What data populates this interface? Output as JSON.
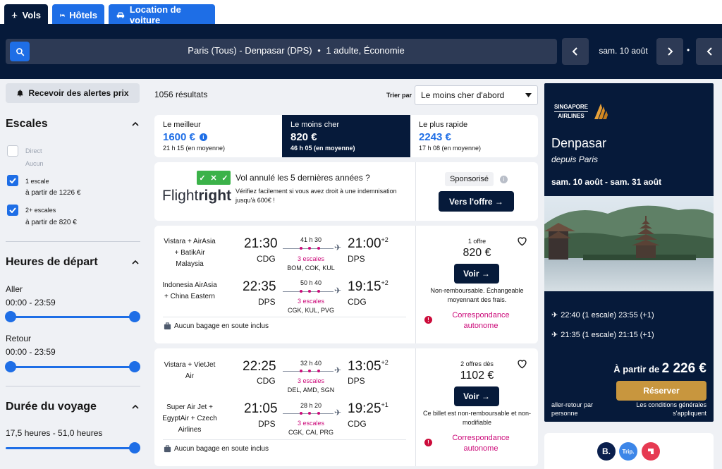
{
  "tabs": [
    {
      "label": "Vols",
      "icon": "plane-icon"
    },
    {
      "label": "Hôtels",
      "icon": "bed-icon"
    },
    {
      "label": "Location de voiture",
      "icon": "car-icon"
    }
  ],
  "search": {
    "route": "Paris (Tous) - Denpasar (DPS)",
    "separator": "•",
    "travellers": "1 adulte, Économie",
    "date": "sam. 10 août",
    "dot": "•"
  },
  "sidebar": {
    "alert_label": "Recevoir des alertes prix",
    "stops_title": "Escales",
    "stops": [
      {
        "label": "Direct",
        "sub": "Aucun",
        "checked": false
      },
      {
        "label": "1 escale",
        "sub": "à partir de 1226 €",
        "checked": true
      },
      {
        "label": "2+ escales",
        "sub": "à partir de 820 €",
        "checked": true
      }
    ],
    "departure_title": "Heures de départ",
    "outbound_label": "Aller",
    "outbound_range": "00:00 - 23:59",
    "return_label": "Retour",
    "return_range": "00:00 - 23:59",
    "duration_title": "Durée du voyage",
    "duration_range": "17,5 heures - 51,0 heures"
  },
  "results": {
    "count": "1056 résultats",
    "sort_label": "Trier par",
    "sort_value": "Le moins cher d'abord"
  },
  "sort_tabs": [
    {
      "title": "Le meilleur",
      "price": "1600 €",
      "duration": "21 h 15 (en moyenne)"
    },
    {
      "title": "Le moins cher",
      "price": "820 €",
      "duration": "46 h 05 (en moyenne)"
    },
    {
      "title": "Le plus rapide",
      "price": "2243 €",
      "duration": "17 h 08 (en moyenne)"
    }
  ],
  "sponsor": {
    "headline": "Vol annulé les 5 dernières années ?",
    "text": "Vérifiez facilement si vous avez droit à une indemnisation jusqu'à 600€ !",
    "brand_a": "Flight",
    "brand_b": "right",
    "badge": "Sponsorisé",
    "cta": "Vers l'offre →"
  },
  "flights": [
    {
      "legs": [
        {
          "airline": "Vistara + AirAsia + BatikAir Malaysia",
          "dep_time": "21:30",
          "dep_apt": "CDG",
          "duration": "41 h 30",
          "stops": "3 escales",
          "via": "BOM, COK, KUL",
          "arr_time": "21:00",
          "arr_offset": "+2",
          "arr_apt": "DPS"
        },
        {
          "airline": "Indonesia AirAsia + China Eastern",
          "dep_time": "22:35",
          "dep_apt": "DPS",
          "duration": "50 h 40",
          "stops": "3 escales",
          "via": "CGK, KUL, PVG",
          "arr_time": "19:15",
          "arr_offset": "+2",
          "arr_apt": "CDG"
        }
      ],
      "baggage": "Aucun bagage en soute inclus",
      "offers": "1 offre",
      "price": "820 €",
      "cta": "Voir →",
      "note": "Non-remboursable. Échangeable moyennant des frais.",
      "warning": "Correspondance autonome"
    },
    {
      "legs": [
        {
          "airline": "Vistara + VietJet Air",
          "dep_time": "22:25",
          "dep_apt": "CDG",
          "duration": "32 h 40",
          "stops": "3 escales",
          "via": "DEL, AMD, SGN",
          "arr_time": "13:05",
          "arr_offset": "+2",
          "arr_apt": "DPS"
        },
        {
          "airline": "Super Air Jet + EgyptAir + Czech Airlines",
          "dep_time": "21:05",
          "dep_apt": "DPS",
          "duration": "28 h 20",
          "stops": "3 escales",
          "via": "CGK, CAI, PRG",
          "arr_time": "19:25",
          "arr_offset": "+1",
          "arr_apt": "CDG"
        }
      ],
      "baggage": "Aucun bagage en soute inclus",
      "offers": "2 offres dès",
      "price": "1102 €",
      "cta": "Voir →",
      "note": "Ce billet est non-remboursable et non-modifiable",
      "warning": "Correspondance autonome"
    }
  ],
  "ad": {
    "brand_line1": "SINGAPORE",
    "brand_line2": "AIRLINES",
    "city": "Denpasar",
    "origin": "depuis Paris",
    "dates": "sam. 10 août - sam. 31 août",
    "outbound": "22:40 (1 escale) 23:55 (+1)",
    "return": "21:35 (1 escale) 21:15 (+1)",
    "from_label": "À partir de",
    "price": "2 226 €",
    "cta": "Réserver",
    "footnote_left": "aller-retour par personne",
    "footnote_right": "Les conditions générales s'appliquent"
  },
  "partners": {
    "b": "B.",
    "trip": "Trip."
  },
  "colors": {
    "navy": "#061a3a",
    "accent": "#1e6ee6",
    "magenta": "#cc0b7a",
    "gold": "#c8963e"
  }
}
